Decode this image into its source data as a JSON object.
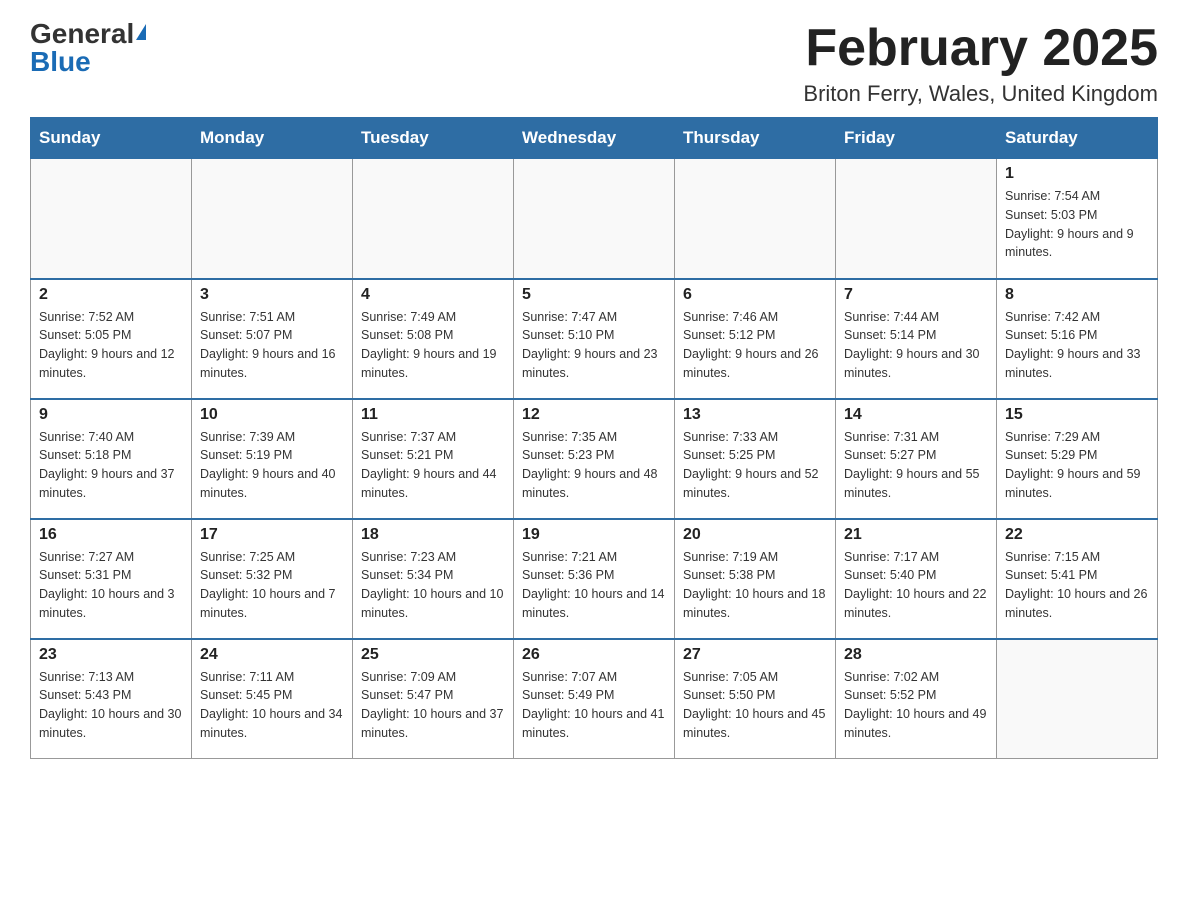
{
  "header": {
    "logo_general": "General",
    "logo_blue": "Blue",
    "month_title": "February 2025",
    "location": "Briton Ferry, Wales, United Kingdom"
  },
  "weekdays": [
    "Sunday",
    "Monday",
    "Tuesday",
    "Wednesday",
    "Thursday",
    "Friday",
    "Saturday"
  ],
  "weeks": [
    [
      {
        "day": "",
        "info": ""
      },
      {
        "day": "",
        "info": ""
      },
      {
        "day": "",
        "info": ""
      },
      {
        "day": "",
        "info": ""
      },
      {
        "day": "",
        "info": ""
      },
      {
        "day": "",
        "info": ""
      },
      {
        "day": "1",
        "info": "Sunrise: 7:54 AM\nSunset: 5:03 PM\nDaylight: 9 hours and 9 minutes."
      }
    ],
    [
      {
        "day": "2",
        "info": "Sunrise: 7:52 AM\nSunset: 5:05 PM\nDaylight: 9 hours and 12 minutes."
      },
      {
        "day": "3",
        "info": "Sunrise: 7:51 AM\nSunset: 5:07 PM\nDaylight: 9 hours and 16 minutes."
      },
      {
        "day": "4",
        "info": "Sunrise: 7:49 AM\nSunset: 5:08 PM\nDaylight: 9 hours and 19 minutes."
      },
      {
        "day": "5",
        "info": "Sunrise: 7:47 AM\nSunset: 5:10 PM\nDaylight: 9 hours and 23 minutes."
      },
      {
        "day": "6",
        "info": "Sunrise: 7:46 AM\nSunset: 5:12 PM\nDaylight: 9 hours and 26 minutes."
      },
      {
        "day": "7",
        "info": "Sunrise: 7:44 AM\nSunset: 5:14 PM\nDaylight: 9 hours and 30 minutes."
      },
      {
        "day": "8",
        "info": "Sunrise: 7:42 AM\nSunset: 5:16 PM\nDaylight: 9 hours and 33 minutes."
      }
    ],
    [
      {
        "day": "9",
        "info": "Sunrise: 7:40 AM\nSunset: 5:18 PM\nDaylight: 9 hours and 37 minutes."
      },
      {
        "day": "10",
        "info": "Sunrise: 7:39 AM\nSunset: 5:19 PM\nDaylight: 9 hours and 40 minutes."
      },
      {
        "day": "11",
        "info": "Sunrise: 7:37 AM\nSunset: 5:21 PM\nDaylight: 9 hours and 44 minutes."
      },
      {
        "day": "12",
        "info": "Sunrise: 7:35 AM\nSunset: 5:23 PM\nDaylight: 9 hours and 48 minutes."
      },
      {
        "day": "13",
        "info": "Sunrise: 7:33 AM\nSunset: 5:25 PM\nDaylight: 9 hours and 52 minutes."
      },
      {
        "day": "14",
        "info": "Sunrise: 7:31 AM\nSunset: 5:27 PM\nDaylight: 9 hours and 55 minutes."
      },
      {
        "day": "15",
        "info": "Sunrise: 7:29 AM\nSunset: 5:29 PM\nDaylight: 9 hours and 59 minutes."
      }
    ],
    [
      {
        "day": "16",
        "info": "Sunrise: 7:27 AM\nSunset: 5:31 PM\nDaylight: 10 hours and 3 minutes."
      },
      {
        "day": "17",
        "info": "Sunrise: 7:25 AM\nSunset: 5:32 PM\nDaylight: 10 hours and 7 minutes."
      },
      {
        "day": "18",
        "info": "Sunrise: 7:23 AM\nSunset: 5:34 PM\nDaylight: 10 hours and 10 minutes."
      },
      {
        "day": "19",
        "info": "Sunrise: 7:21 AM\nSunset: 5:36 PM\nDaylight: 10 hours and 14 minutes."
      },
      {
        "day": "20",
        "info": "Sunrise: 7:19 AM\nSunset: 5:38 PM\nDaylight: 10 hours and 18 minutes."
      },
      {
        "day": "21",
        "info": "Sunrise: 7:17 AM\nSunset: 5:40 PM\nDaylight: 10 hours and 22 minutes."
      },
      {
        "day": "22",
        "info": "Sunrise: 7:15 AM\nSunset: 5:41 PM\nDaylight: 10 hours and 26 minutes."
      }
    ],
    [
      {
        "day": "23",
        "info": "Sunrise: 7:13 AM\nSunset: 5:43 PM\nDaylight: 10 hours and 30 minutes."
      },
      {
        "day": "24",
        "info": "Sunrise: 7:11 AM\nSunset: 5:45 PM\nDaylight: 10 hours and 34 minutes."
      },
      {
        "day": "25",
        "info": "Sunrise: 7:09 AM\nSunset: 5:47 PM\nDaylight: 10 hours and 37 minutes."
      },
      {
        "day": "26",
        "info": "Sunrise: 7:07 AM\nSunset: 5:49 PM\nDaylight: 10 hours and 41 minutes."
      },
      {
        "day": "27",
        "info": "Sunrise: 7:05 AM\nSunset: 5:50 PM\nDaylight: 10 hours and 45 minutes."
      },
      {
        "day": "28",
        "info": "Sunrise: 7:02 AM\nSunset: 5:52 PM\nDaylight: 10 hours and 49 minutes."
      },
      {
        "day": "",
        "info": ""
      }
    ]
  ]
}
